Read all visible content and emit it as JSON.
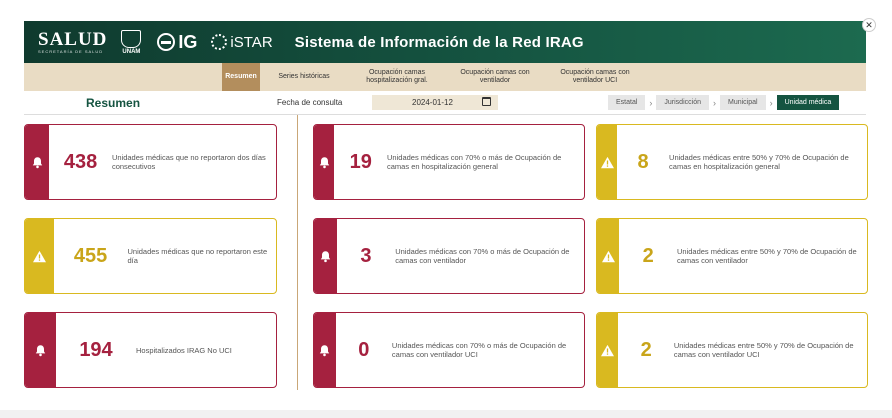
{
  "header": {
    "salud": "SALUD",
    "salud_sub": "SECRETARÍA DE SALUD",
    "unam": "UNAM",
    "ig": "IG",
    "istar": "iSTAR",
    "title": "Sistema de Información de la Red IRAG"
  },
  "nav": {
    "tabs": [
      {
        "label": "Resumen",
        "active": true
      },
      {
        "label": "Series históricas"
      },
      {
        "label": "Ocupación camas hospitalización gral."
      },
      {
        "label": "Ocupación camas con ventilador"
      },
      {
        "label": "Ocupación camas con ventilador UCI"
      }
    ]
  },
  "toolbar": {
    "section": "Resumen",
    "fecha_label": "Fecha de consulta",
    "fecha_value": "2024-01-12",
    "crumbs": [
      "Estatal",
      "Jurisdicción",
      "Municipal",
      "Unidad médica"
    ]
  },
  "cards": [
    {
      "value": "438",
      "desc": "Unidades médicas que no reportaron dos días consecutivos",
      "color": "red",
      "icon": "bell-icon"
    },
    {
      "value": "19",
      "desc": "Unidades médicas con 70% o más de Ocupación de camas en hospitalización general",
      "color": "red",
      "icon": "bell-icon"
    },
    {
      "value": "8",
      "desc": "Unidades médicas entre 50% y 70% de Ocupación de camas en hospitalización general",
      "color": "yellow",
      "icon": "warning-icon"
    },
    {
      "value": "455",
      "desc": "Unidades médicas que no reportaron este día",
      "color": "yellow",
      "icon": "warning-icon"
    },
    {
      "value": "3",
      "desc": "Unidades médicas con 70% o más de Ocupación de camas con ventilador",
      "color": "red",
      "icon": "bell-icon"
    },
    {
      "value": "2",
      "desc": "Unidades médicas entre 50% y 70% de Ocupación de camas con ventilador",
      "color": "yellow",
      "icon": "warning-icon"
    },
    {
      "value": "194",
      "desc": "Hospitalizados IRAG No UCI",
      "color": "red",
      "icon": "bell-icon"
    },
    {
      "value": "0",
      "desc": "Unidades médicas con 70% o más de Ocupación de camas con ventilador UCI",
      "color": "red",
      "icon": "bell-icon"
    },
    {
      "value": "2",
      "desc": "Unidades médicas entre 50% y 70% de Ocupación de camas con ventilador UCI",
      "color": "yellow",
      "icon": "warning-icon"
    }
  ],
  "colors": {
    "red": "#a5213f",
    "yellow": "#d9b920",
    "green": "#155441",
    "gold": "#b38e5d"
  }
}
